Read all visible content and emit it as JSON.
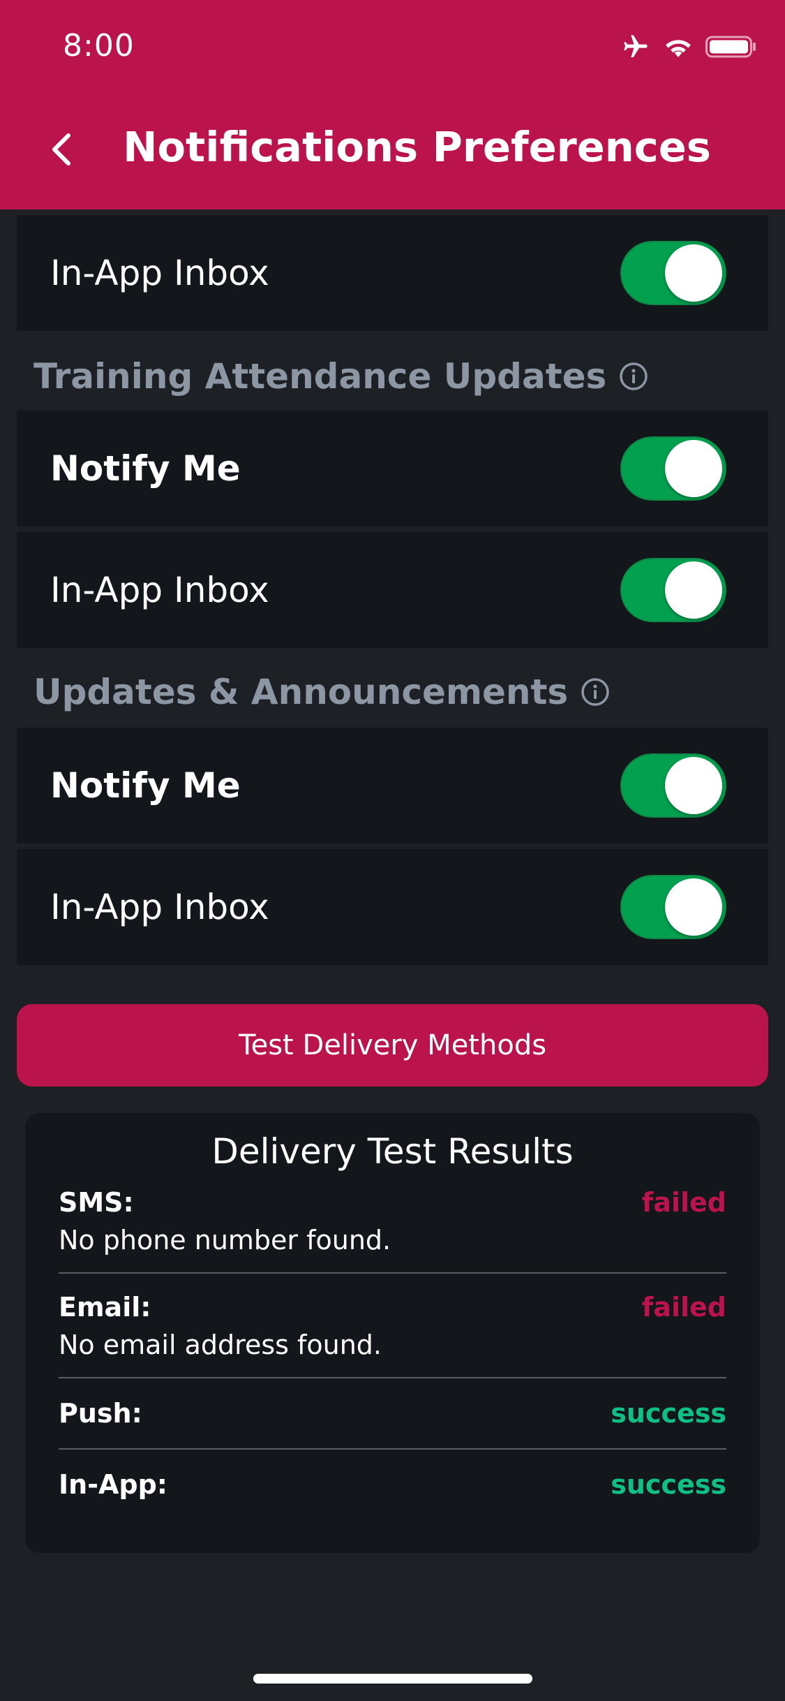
{
  "status_bar": {
    "time": "8:00",
    "icons": [
      "airplane-icon",
      "wifi-icon",
      "battery-icon"
    ]
  },
  "header": {
    "title": "Notifications Preferences",
    "back_icon": "chevron-left-icon"
  },
  "sections": [
    {
      "rows": [
        {
          "label": "In-App Inbox",
          "enabled": true
        }
      ]
    },
    {
      "title": "Training Attendance Updates",
      "rows": [
        {
          "label": "Notify Me",
          "enabled": true
        },
        {
          "label": "In-App Inbox",
          "enabled": true
        }
      ]
    },
    {
      "title": "Updates & Announcements",
      "rows": [
        {
          "label": "Notify Me",
          "enabled": true
        },
        {
          "label": "In-App Inbox",
          "enabled": true
        }
      ]
    }
  ],
  "test_button": {
    "label": "Test Delivery Methods"
  },
  "results": {
    "title": "Delivery Test Results",
    "items": [
      {
        "name": "SMS:",
        "status": "failed",
        "detail": "No phone number found."
      },
      {
        "name": "Email:",
        "status": "failed",
        "detail": "No email address found."
      },
      {
        "name": "Push:",
        "status": "success"
      },
      {
        "name": "In-App:",
        "status": "success"
      }
    ]
  },
  "colors": {
    "accent": "#bb134b",
    "toggle_on": "#02a04f",
    "success": "#0fbf83",
    "failed": "#bb134b",
    "background": "#1d2025",
    "card": "#13161a",
    "section_title": "#8d96a3"
  }
}
